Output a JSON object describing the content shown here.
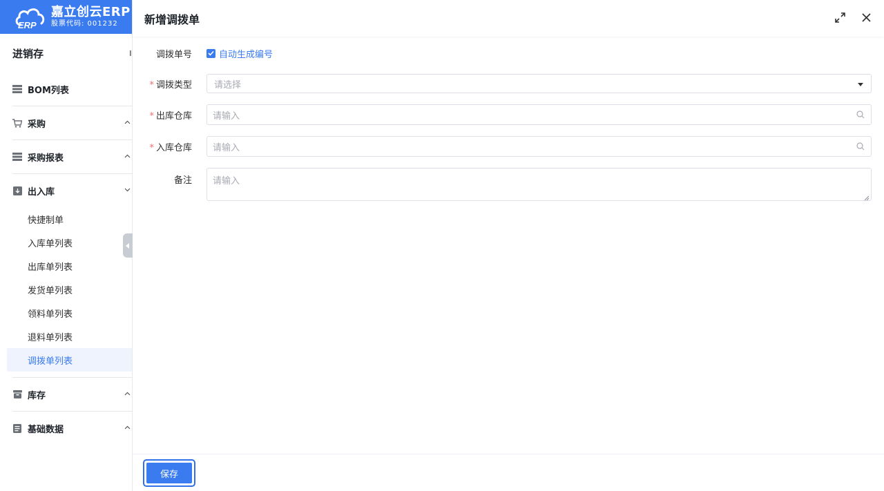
{
  "brand": {
    "title": "嘉立创云ERP",
    "subtitle": "股票代码: 001232",
    "color": "#3a7bf0"
  },
  "sidebar": {
    "section_title": "进销存",
    "groups": [
      {
        "label": "BOM列表",
        "icon": "list-icon",
        "arrow": ""
      },
      {
        "label": "采购",
        "icon": "cart-icon",
        "arrow": "^"
      },
      {
        "label": "采购报表",
        "icon": "report-icon",
        "arrow": "^"
      },
      {
        "label": "出入库",
        "icon": "warehouse-box-icon",
        "arrow": "v",
        "items": [
          "快捷制单",
          "入库单列表",
          "出库单列表",
          "发货单列表",
          "领料单列表",
          "退料单列表",
          "调拨单列表"
        ],
        "active": "调拨单列表"
      },
      {
        "label": "库存",
        "icon": "inventory-icon",
        "arrow": "^"
      },
      {
        "label": "基础数据",
        "icon": "base-data-icon",
        "arrow": "^"
      }
    ]
  },
  "dialog": {
    "title": "新增调拨单",
    "form": {
      "transfer_no": {
        "label": "调拨单号",
        "checkbox_label": "自动生成编号",
        "checked": true
      },
      "transfer_type": {
        "label": "调拨类型",
        "placeholder": "请选择",
        "required": true
      },
      "out_warehouse": {
        "label": "出库仓库",
        "placeholder": "请输入",
        "required": true
      },
      "in_warehouse": {
        "label": "入库仓库",
        "placeholder": "请输入",
        "required": true
      },
      "remark": {
        "label": "备注",
        "placeholder": "请输入"
      }
    },
    "save_label": "保存",
    "required_mark": "*"
  }
}
